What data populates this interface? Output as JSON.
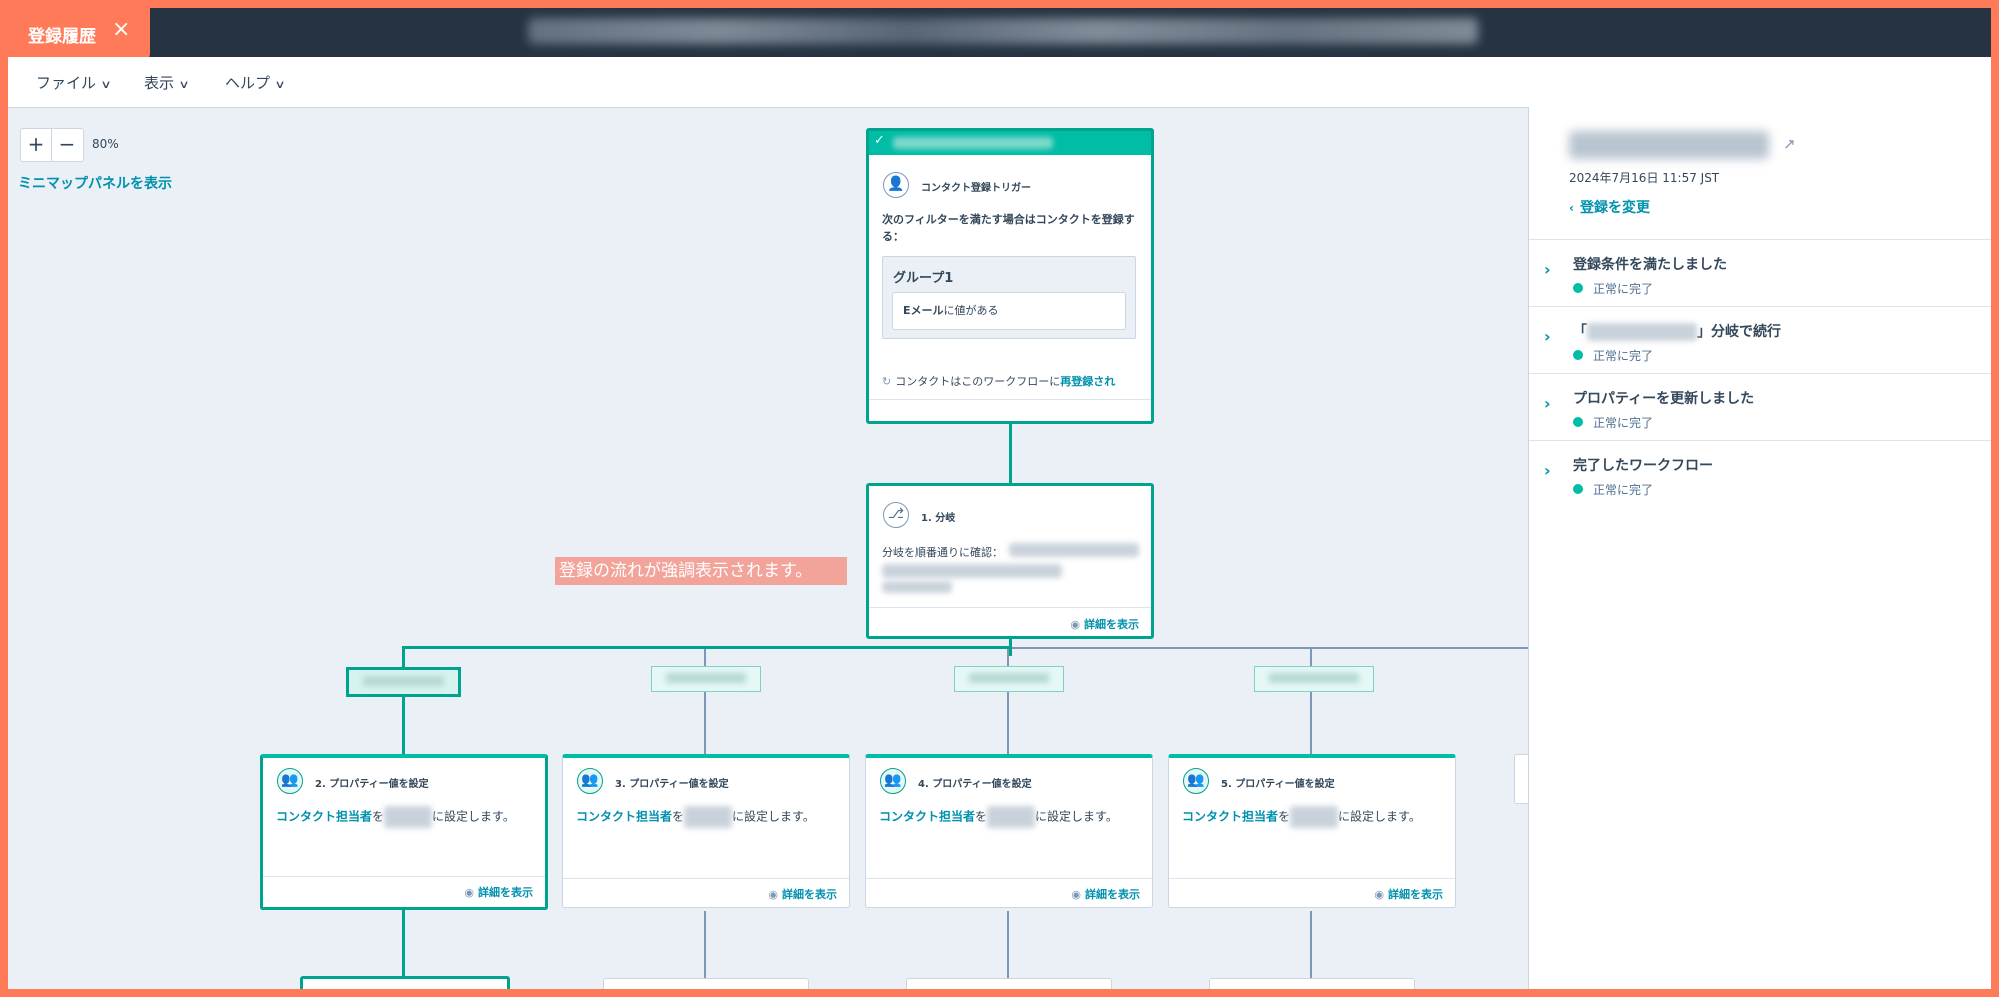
{
  "window": {
    "tab_title": "登録履歴",
    "close_icon": "×"
  },
  "menu": {
    "file": "ファイル",
    "view": "表示",
    "help": "ヘルプ"
  },
  "canvas": {
    "zoom_in": "+",
    "zoom_out": "−",
    "zoom_level": "80%",
    "minimap_link": "ミニマップパネルを表示",
    "annotation": "登録の流れが強調表示されます。"
  },
  "trigger": {
    "type_label": "コンタクト登録トリガー",
    "description": "次のフィルターを満たす場合はコンタクトを登録する：",
    "group_title": "グループ1",
    "filter_bold": "Eメール",
    "filter_rest": "に値がある",
    "reenroll_prefix": "コンタクトはこのワークフローに",
    "reenroll_link": "再登録され"
  },
  "branch": {
    "title": "1. 分岐",
    "text": "分岐を順番通りに確認：",
    "details": "詳細を表示"
  },
  "actions": [
    {
      "title": "2. プロパティー値を設定",
      "link": "コンタクト担当者",
      "mid": "を",
      "suffix": "に設定します。",
      "details": "詳細を表示"
    },
    {
      "title": "3. プロパティー値を設定",
      "link": "コンタクト担当者",
      "mid": "を",
      "suffix": "に設定します。",
      "details": "詳細を表示"
    },
    {
      "title": "4. プロパティー値を設定",
      "link": "コンタクト担当者",
      "mid": "を",
      "suffix": "に設定します。",
      "details": "詳細を表示"
    },
    {
      "title": "5. プロパティー値を設定",
      "link": "コンタクト担当者",
      "mid": "を",
      "suffix": "に設定します。",
      "details": "詳細を表示"
    }
  ],
  "right_panel": {
    "date": "2024年7月16日 11:57 JST",
    "change_link": "登録を変更",
    "steps": [
      {
        "title": "登録条件を満たしました",
        "status": "正常に完了"
      },
      {
        "title_prefix": "「",
        "title_suffix": "」分岐で続行",
        "status": "正常に完了"
      },
      {
        "title": "プロパティーを更新しました",
        "status": "正常に完了"
      },
      {
        "title": "完了したワークフロー",
        "status": "正常に完了"
      }
    ]
  },
  "colors": {
    "accent_orange": "#ff7a59",
    "teal": "#00bda5",
    "link": "#0091ae",
    "topbar": "#253342"
  }
}
